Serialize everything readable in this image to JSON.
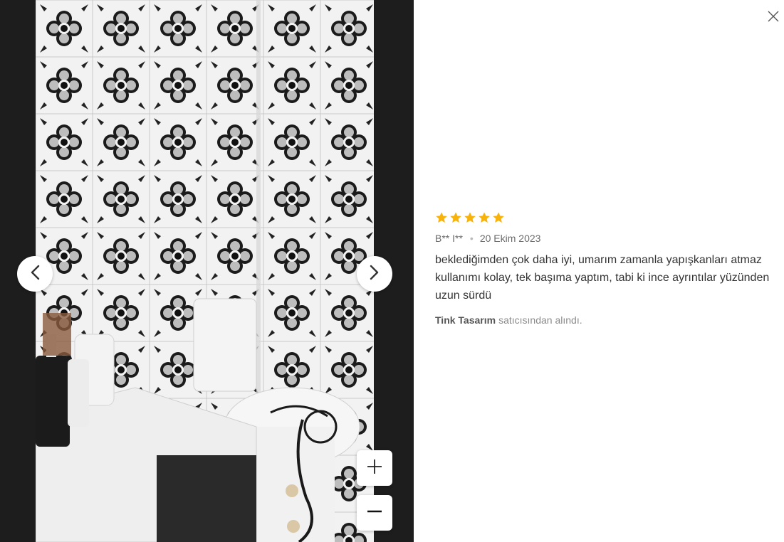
{
  "review": {
    "rating": 5,
    "rating_max": 5,
    "author": "B** I**",
    "date": "20 Ekim 2023",
    "comment": "beklediğimden çok daha iyi, umarım zamanla yapışkanları atmaz kullanımı kolay, tek başıma yaptım, tabi ki ince ayrıntılar yüzünden uzun sürdü",
    "seller_name": "Tink Tasarım",
    "seller_suffix": "satıcısından alındı."
  },
  "colors": {
    "star": "#f7b30c",
    "viewer_bg": "#1d1d1d"
  },
  "icons": {
    "prev": "chevron-left-icon",
    "next": "chevron-right-icon",
    "zoom_in": "plus-icon",
    "zoom_out": "minus-icon",
    "close": "close-icon"
  }
}
